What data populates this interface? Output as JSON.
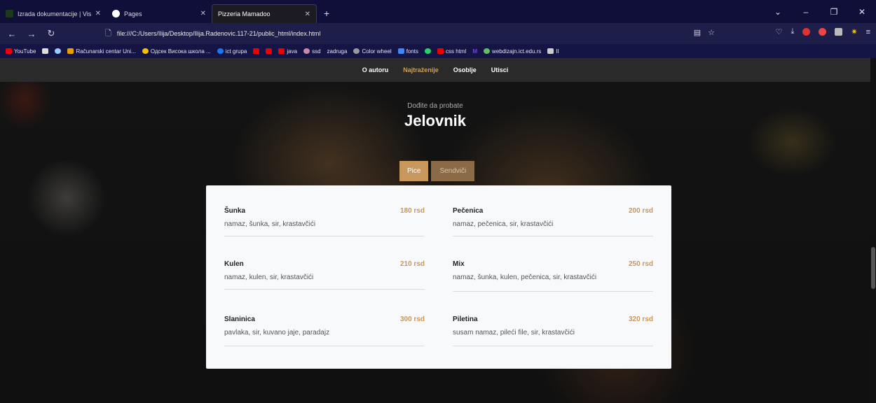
{
  "browser": {
    "tabs": [
      {
        "title": "Izrada dokumentacije | Visoka š",
        "active": false
      },
      {
        "title": "Pages",
        "active": false
      },
      {
        "title": "Pizzeria Mamadoo",
        "active": true
      }
    ],
    "new_tab": "+",
    "url": "file:///C:/Users/Ilija/Desktop/Ilija.Radenovic.117-21/public_html/index.html",
    "bookmarks": [
      "YouTube",
      "Računarski centar Uni...",
      "Одсек Висока школа ...",
      "ict grupa",
      "java",
      "ssd",
      "zadruga",
      "Color wheel",
      "fonts",
      "css html",
      "webdizajn.ict.edu.rs",
      "II"
    ]
  },
  "site": {
    "nav": [
      {
        "label": "O autoru",
        "active": false
      },
      {
        "label": "Najtraženije",
        "active": true
      },
      {
        "label": "Osoblje",
        "active": false
      },
      {
        "label": "Utisci",
        "active": false
      }
    ],
    "hero_subtitle": "Dođite da probate",
    "hero_title": "Jelovnik",
    "filters": [
      {
        "label": "Pice",
        "active": true
      },
      {
        "label": "Sendviči",
        "active": false
      }
    ],
    "menu": [
      {
        "name": "Šunka",
        "price": "180 rsd",
        "desc": "namaz, šunka, sir, krastavčići"
      },
      {
        "name": "Pečenica",
        "price": "200 rsd",
        "desc": "namaz, pečenica, sir, krastavčići"
      },
      {
        "name": "Kulen",
        "price": "210 rsd",
        "desc": "namaz, kulen, sir, krastavčići"
      },
      {
        "name": "Mix",
        "price": "250 rsd",
        "desc": "namaz, šunka, kulen, pečenica, sir, krastavčići"
      },
      {
        "name": "Slaninica",
        "price": "300 rsd",
        "desc": "pavlaka, sir, kuvano jaje, paradajz"
      },
      {
        "name": "Piletina",
        "price": "320 rsd",
        "desc": "susam namaz, pileći file, sir, krastavčići"
      }
    ]
  },
  "colors": {
    "accent": "#c8975b",
    "nav_bg": "#2a2a2a",
    "card_bg": "#f8f9fb"
  }
}
